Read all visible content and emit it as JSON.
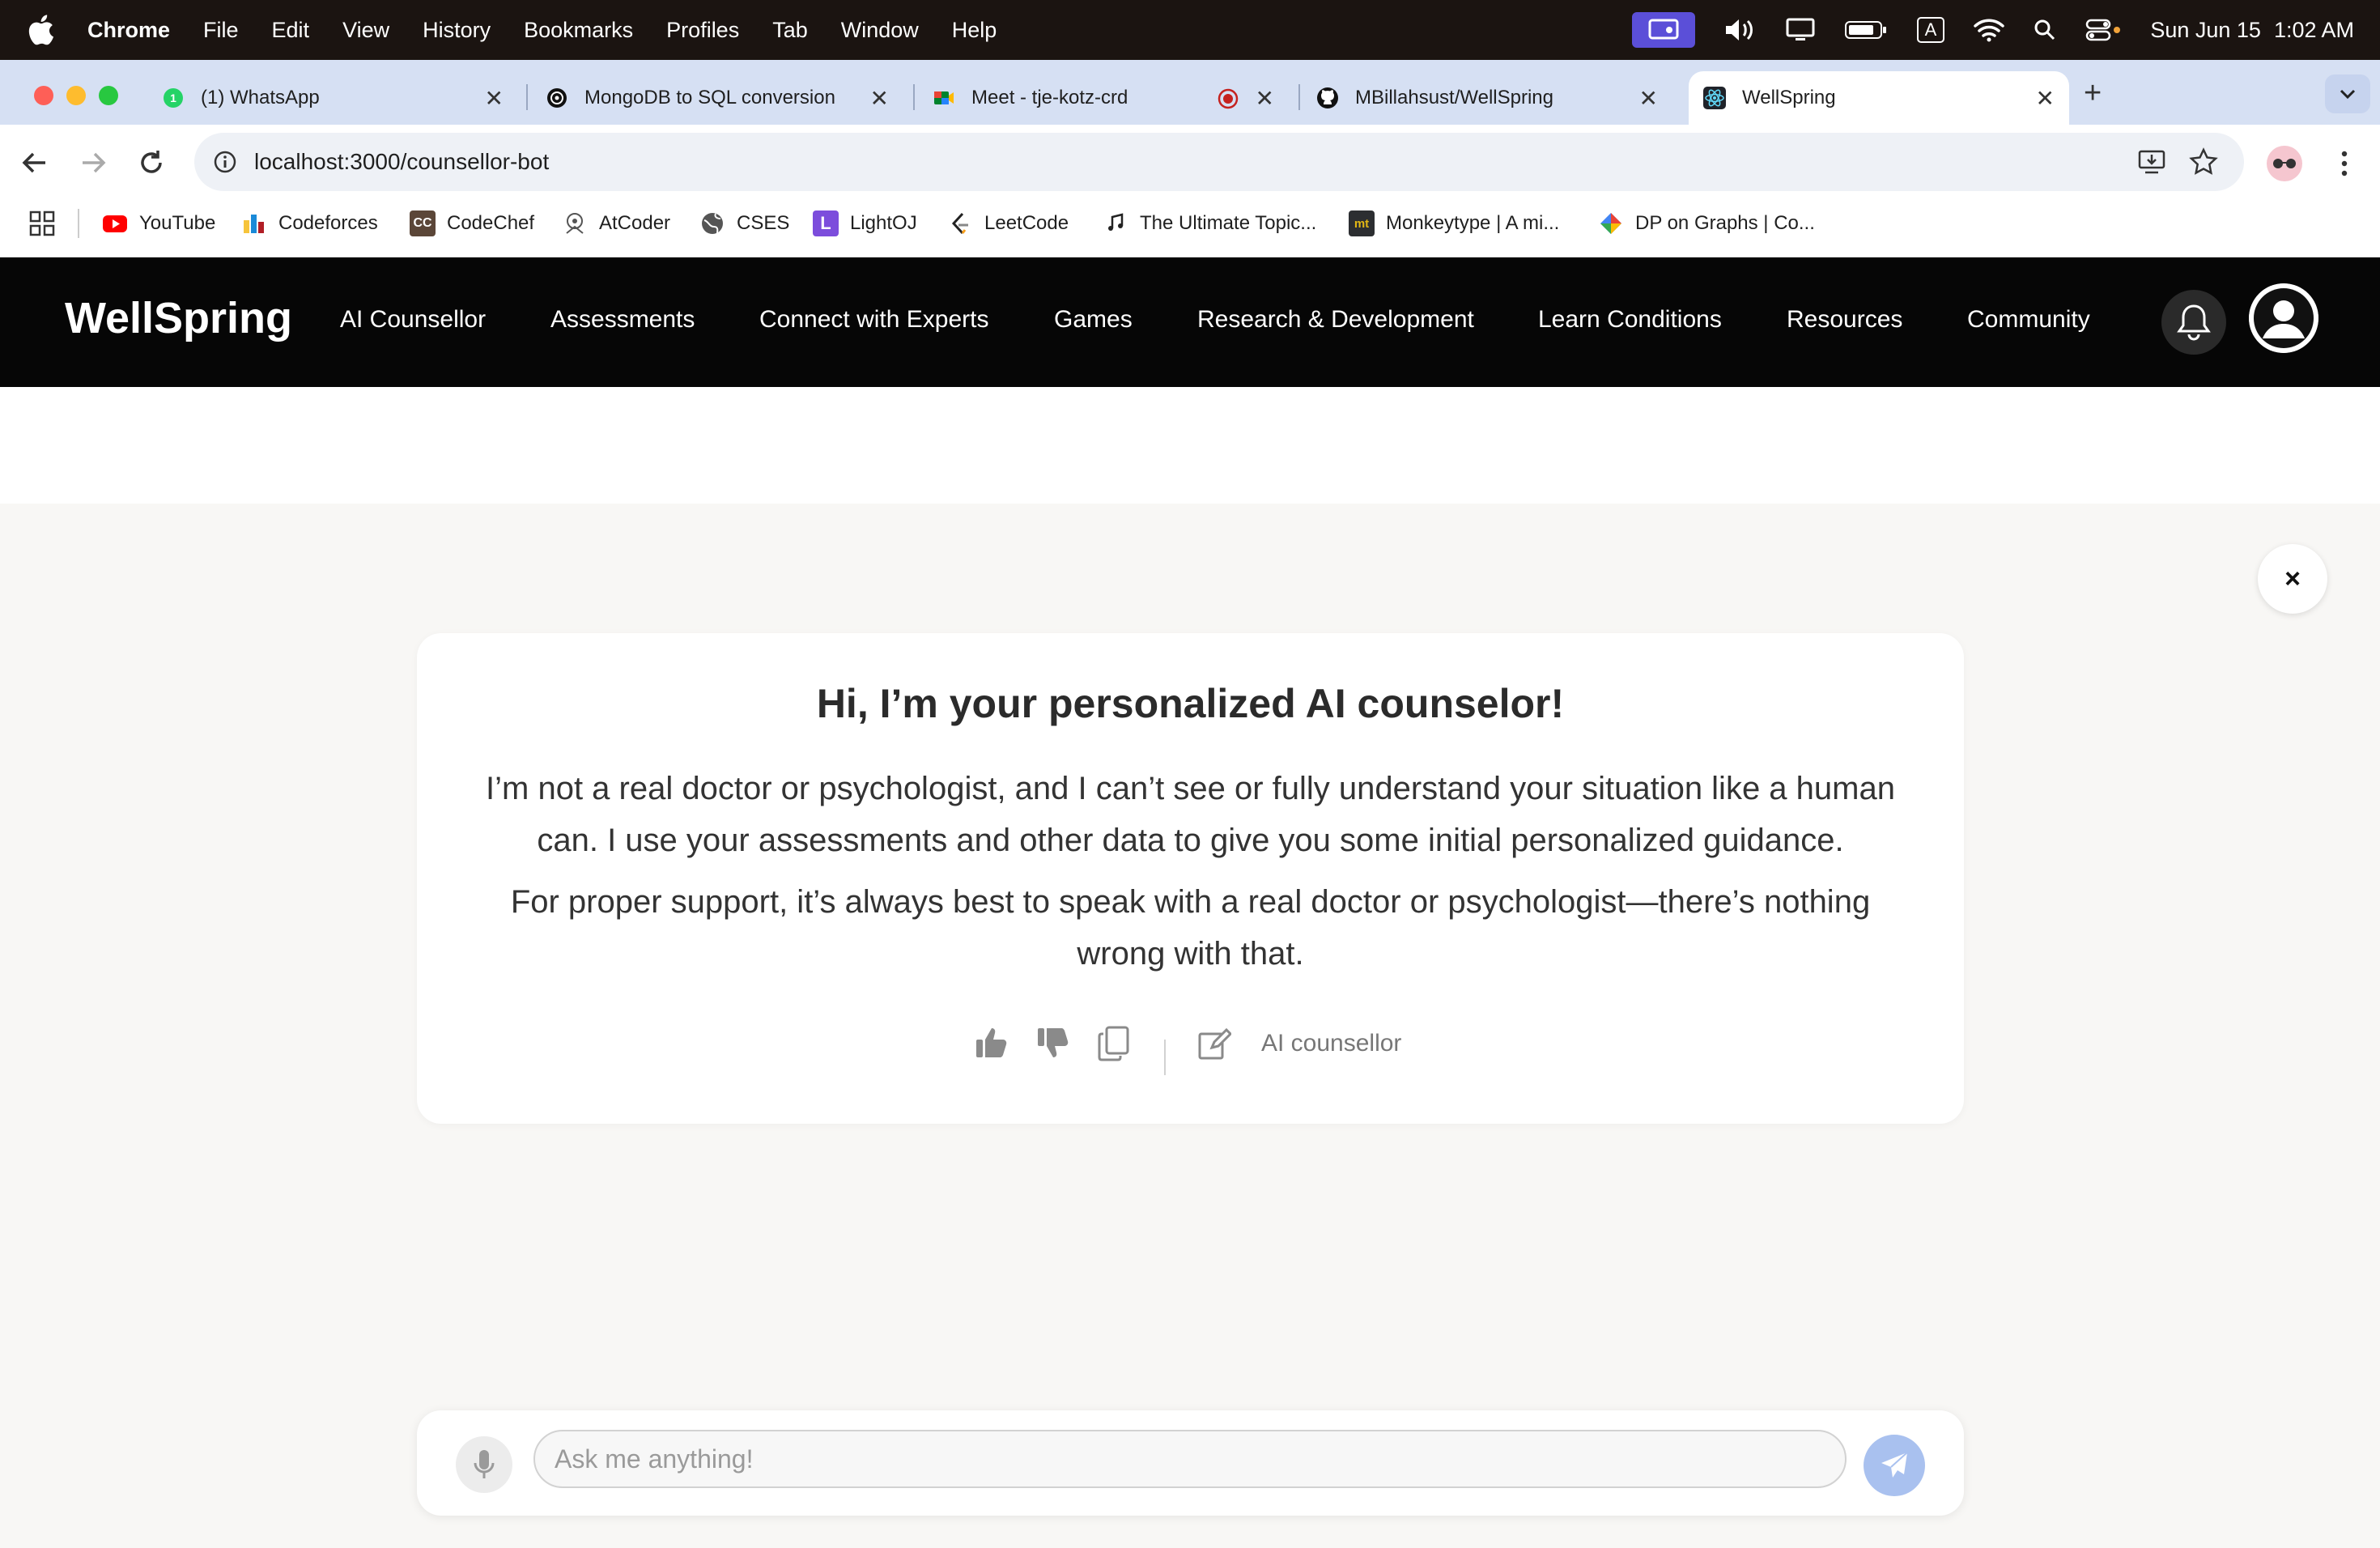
{
  "os_menubar": {
    "app_name": "Chrome",
    "items": [
      "File",
      "Edit",
      "View",
      "History",
      "Bookmarks",
      "Profiles",
      "Tab",
      "Window",
      "Help"
    ],
    "status": {
      "keyboard_indicator": "A",
      "date": "Sun Jun 15",
      "time": "1:02 AM"
    }
  },
  "browser": {
    "tabs": [
      {
        "title": "(1) WhatsApp",
        "favicon": "whatsapp-icon",
        "active": false
      },
      {
        "title": "MongoDB to SQL conversion",
        "favicon": "chatgpt-icon",
        "active": false
      },
      {
        "title": "Meet - tje-kotz-crd",
        "favicon": "google-meet-icon",
        "active": false,
        "recording": true
      },
      {
        "title": "MBillahsust/WellSpring",
        "favicon": "github-icon",
        "active": false
      },
      {
        "title": "WellSpring",
        "favicon": "react-icon",
        "active": true
      }
    ],
    "url": "localhost:3000/counsellor-bot",
    "bookmarks": [
      {
        "label": "YouTube",
        "icon": "youtube-icon"
      },
      {
        "label": "Codeforces",
        "icon": "codeforces-icon"
      },
      {
        "label": "CodeChef",
        "icon": "codechef-icon",
        "glyph": "CC"
      },
      {
        "label": "AtCoder",
        "icon": "atcoder-icon"
      },
      {
        "label": "CSES",
        "icon": "globe-icon"
      },
      {
        "label": "LightOJ",
        "icon": "lightoj-icon",
        "glyph": "L"
      },
      {
        "label": "LeetCode",
        "icon": "leetcode-icon"
      },
      {
        "label": "The Ultimate Topic...",
        "icon": "music-note-icon"
      },
      {
        "label": "Monkeytype | A mi...",
        "icon": "monkeytype-icon",
        "glyph": "mt"
      },
      {
        "label": "DP on Graphs | Co...",
        "icon": "dp-graphs-icon"
      }
    ]
  },
  "app": {
    "brand": "WellSpring",
    "nav": [
      "AI Counsellor",
      "Assessments",
      "Connect with Experts",
      "Games",
      "Research & Development",
      "Learn Conditions",
      "Resources",
      "Community"
    ],
    "close_glyph": "×"
  },
  "message": {
    "title": "Hi, I’m your personalized AI counselor!",
    "paragraph_1": "I’m not a real doctor or psychologist, and I can’t see or fully understand your situation like a human can. I use your assessments and other data to give you some initial personalized guidance.",
    "paragraph_2": "For proper support, it’s always best to speak with a real doctor or psychologist—there’s nothing wrong with that.",
    "source_label": "AI counsellor"
  },
  "chat_input": {
    "placeholder": "Ask me anything!",
    "value": ""
  },
  "colors": {
    "nav_bg": "#060606",
    "page_bg": "#f8f7f5",
    "send_button": "#a9c1ef",
    "tab_strip": "#d6e0f3"
  }
}
